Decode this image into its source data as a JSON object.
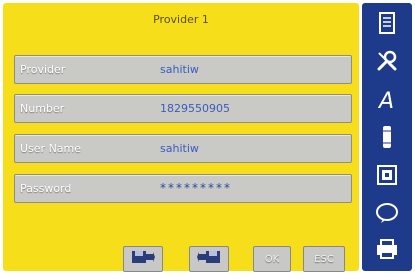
{
  "title": "Provider 1",
  "fields": [
    {
      "label": "Provider",
      "value": "sahitiw"
    },
    {
      "label": "Number",
      "value": "1829550905"
    },
    {
      "label": "User Name",
      "value": "sahitiw"
    },
    {
      "label": "Password",
      "value": "*********"
    }
  ],
  "buttons": {
    "ok": "OK",
    "esc": "ESC"
  },
  "colors": {
    "panel": "#f6df1a",
    "sidebar": "#1e3a8a",
    "field": "#c9c9c6",
    "value_text": "#3b5bc0"
  },
  "icons": [
    "list-icon",
    "tools-icon",
    "font-icon",
    "thread-icon",
    "image-icon",
    "speech-bubble-icon",
    "printer-icon"
  ]
}
